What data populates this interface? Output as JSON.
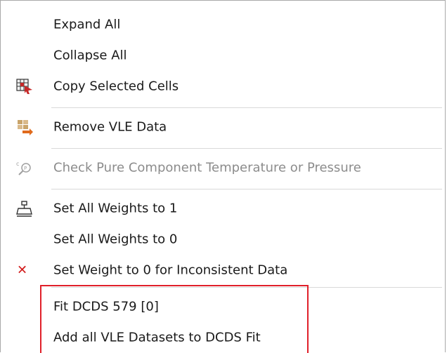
{
  "menu": {
    "items": [
      {
        "label": "Expand All",
        "icon": "none"
      },
      {
        "label": "Collapse All",
        "icon": "none"
      },
      {
        "label": "Copy Selected Cells",
        "icon": "copy-cells-icon"
      },
      {
        "label": "Remove VLE Data",
        "icon": "remove-data-icon"
      },
      {
        "label": "Check Pure Component Temperature or Pressure",
        "icon": "check-pure-icon",
        "disabled": true
      },
      {
        "label": "Set All Weights to 1",
        "icon": "weights-icon"
      },
      {
        "label": "Set All Weights to 0",
        "icon": "none"
      },
      {
        "label": "Set Weight to 0 for Inconsistent Data",
        "icon": "x-icon"
      },
      {
        "label": "Fit DCDS 579 [0]",
        "icon": "none"
      },
      {
        "label": "Add all VLE Datasets to DCDS Fit",
        "icon": "none"
      }
    ]
  },
  "colors": {
    "highlight_border": "#e0202a",
    "x_icon": "#d21b1b",
    "disabled_text": "#8c8c8c"
  }
}
